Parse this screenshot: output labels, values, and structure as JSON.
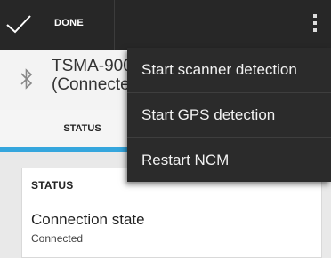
{
  "action_bar": {
    "done_label": "DONE",
    "check_icon": "check-icon",
    "overflow_icon": "overflow-menu-icon"
  },
  "device": {
    "icon": "bluetooth-icon",
    "name_line1": "TSMA-900",
    "name_line2": "(Connecte"
  },
  "tabs": {
    "status_label": "STATUS",
    "indicator_color": "#35a6dd"
  },
  "status_card": {
    "header": "STATUS",
    "connection_state_label": "Connection state",
    "connection_state_value": "Connected"
  },
  "overflow_menu": {
    "items": [
      {
        "label": "Start scanner detection"
      },
      {
        "label": "Start GPS detection"
      },
      {
        "label": "Restart NCM"
      }
    ]
  }
}
